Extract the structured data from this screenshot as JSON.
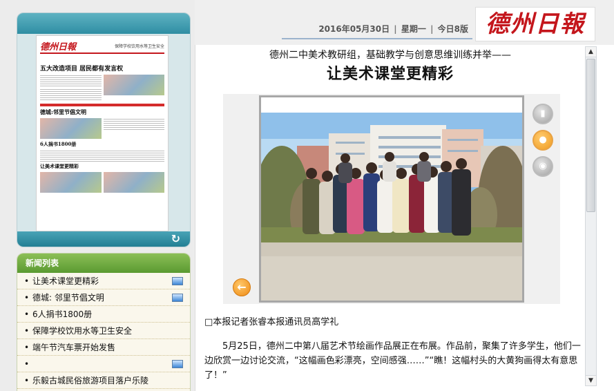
{
  "header": {
    "date": "2016年05月30日",
    "weekday": "星期一",
    "edition": "今日8版",
    "logo": "德州日報"
  },
  "paper_thumb": {
    "logo": "德州日報",
    "headline_top": "保障学校饮用水等卫生安全",
    "headline_main": "五大改造项目 居民都有发言权",
    "headline_2": "德城:邻里节倡文明",
    "headline_3": "6人捐书1800册",
    "headline_4": "让美术课堂更精彩"
  },
  "news_list": {
    "title": "新闻列表",
    "items": [
      {
        "label": "让美术课堂更精彩",
        "has_photo": true
      },
      {
        "label": "德城: 邻里节倡文明",
        "has_photo": true
      },
      {
        "label": "6人捐书1800册",
        "has_photo": false
      },
      {
        "label": "保障学校饮用水等卫生安全",
        "has_photo": false
      },
      {
        "label": "端午节汽车票开始发售",
        "has_photo": false
      },
      {
        "label": "",
        "has_photo": true
      },
      {
        "label": "乐毅古城民俗旅游项目落户乐陵",
        "has_photo": false
      }
    ]
  },
  "article": {
    "subtitle": "德州二中美术教研组，基础教学与创意思维训练并举——",
    "title": "让美术课堂更精彩",
    "byline": "□本报记者张睿本报通讯员高学礼",
    "body": "5月25日，德州二中第八届艺术节绘画作品展正在布展。作品前，聚集了许多学生，他们一边欣赏一边讨论交流，“这幅画色彩漂亮，空间感强……”“瞧！这幅村头的大黄狗画得太有意思了！”"
  },
  "icons": {
    "prev": "arrow-left-icon",
    "video": "video-camera-icon",
    "person": "person-icon",
    "audio": "headphones-icon",
    "refresh": "refresh-icon",
    "photo": "picture-icon"
  },
  "colors": {
    "accent_red": "#c4161c",
    "teal": "#2f8ea3",
    "green": "#5a9a31",
    "orange": "#f09a1f"
  }
}
